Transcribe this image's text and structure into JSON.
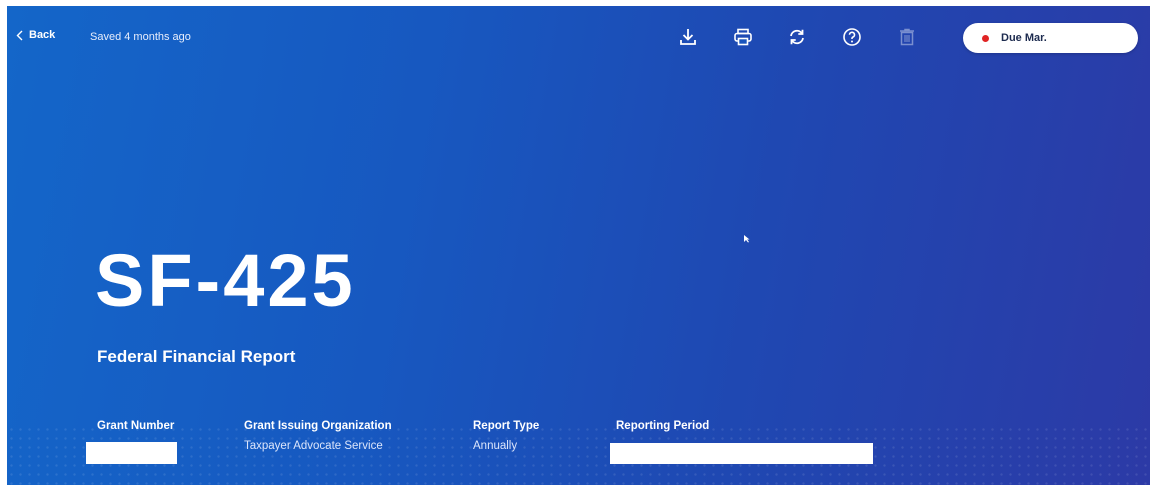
{
  "header": {
    "back_label": "Back",
    "saved_status": "Saved 4 months ago",
    "toolbar": [
      {
        "name": "download-icon"
      },
      {
        "name": "print-icon"
      },
      {
        "name": "refresh-icon"
      },
      {
        "name": "help-icon"
      },
      {
        "name": "trash-icon",
        "disabled": true
      }
    ],
    "due_badge": {
      "label": "Due Mar.",
      "dot_color": "#e02424"
    }
  },
  "form": {
    "code": "SF-425",
    "title": "Federal Financial Report"
  },
  "details": {
    "grant_number": {
      "label": "Grant Number",
      "value": ""
    },
    "grant_issuing_org": {
      "label": "Grant Issuing Organization",
      "value": "Taxpayer Advocate Service"
    },
    "report_type": {
      "label": "Report Type",
      "value": "Annually"
    },
    "reporting_period": {
      "label": "Reporting Period",
      "value": ""
    }
  },
  "colors": {
    "background_start": "#1466c9",
    "background_end": "#2c3aa6",
    "text": "#ffffff"
  }
}
